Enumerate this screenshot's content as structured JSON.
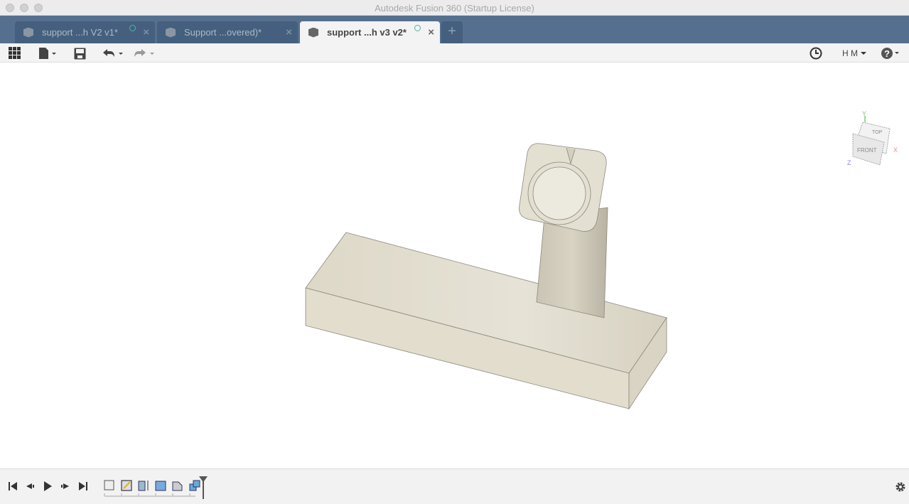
{
  "window": {
    "title": "Autodesk Fusion 360 (Startup License)"
  },
  "tabs": [
    {
      "label": "support ...h V2 v1*",
      "active": false
    },
    {
      "label": "Support ...overed)*",
      "active": false
    },
    {
      "label": "support ...h v3 v2*",
      "active": true
    }
  ],
  "toolbar": {
    "user_initials": "H M"
  },
  "viewcube": {
    "top": "TOP",
    "front": "FRONT",
    "x": "X",
    "y": "Y",
    "z": "Z"
  },
  "colors": {
    "tabbar": "#55708f",
    "model": "#e0dccd"
  }
}
